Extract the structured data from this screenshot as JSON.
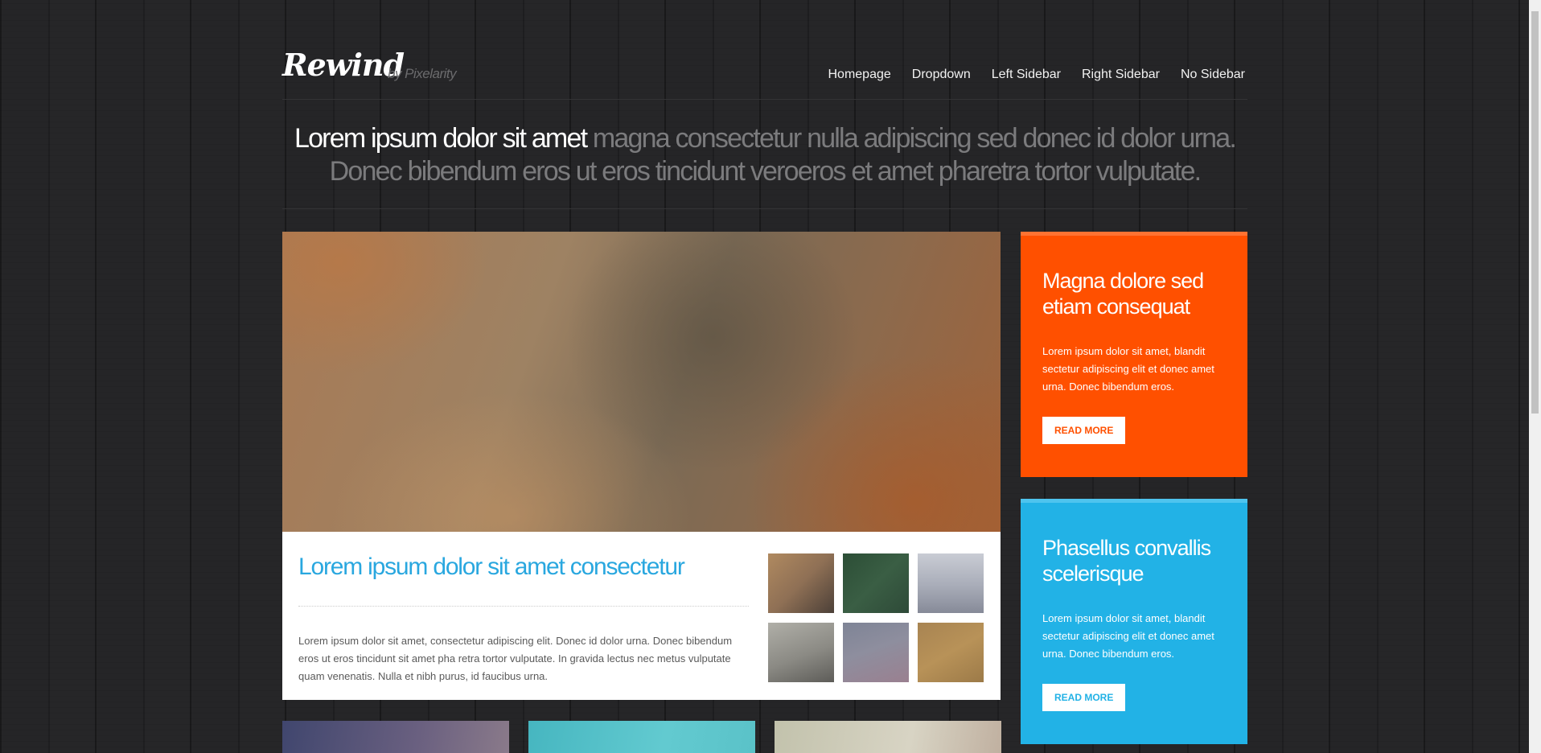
{
  "header": {
    "logo": "Rewind",
    "byline": "by Pixelarity",
    "nav": [
      "Homepage",
      "Dropdown",
      "Left Sidebar",
      "Right Sidebar",
      "No Sidebar"
    ]
  },
  "banner": {
    "strong": "Lorem ipsum dolor sit amet",
    "rest": "magna consectetur nulla adipiscing sed donec id dolor urna. Donec bibendum eros ut eros tincidunt veroeros et amet pharetra tortor vulputate."
  },
  "feature": {
    "title": "Lorem ipsum dolor sit amet consectetur",
    "text": "Lorem ipsum dolor sit amet, consectetur adipiscing elit. Donec id dolor urna. Donec bibendum eros ut eros tincidunt sit amet pha retra tortor vulputate. In gravida lectus nec metus vulputate quam venenatis. Nulla et nibh purus, id faucibus urna."
  },
  "sidebar": [
    {
      "title": "Magna dolore sed etiam consequat",
      "text": "Lorem ipsum dolor sit amet, blandit sectetur adipiscing elit et donec amet urna. Donec bibendum eros.",
      "button": "READ MORE",
      "color": "#ff5000"
    },
    {
      "title": "Phasellus convallis scelerisque",
      "text": "Lorem ipsum dolor sit amet, blandit sectetur adipiscing elit et donec amet urna. Donec bibendum eros.",
      "button": "READ MORE",
      "color": "#22b2e6"
    }
  ],
  "colors": {
    "accent_blue": "#29a7df",
    "orange": "#ff5000",
    "blue": "#22b2e6",
    "background": "#222224"
  }
}
